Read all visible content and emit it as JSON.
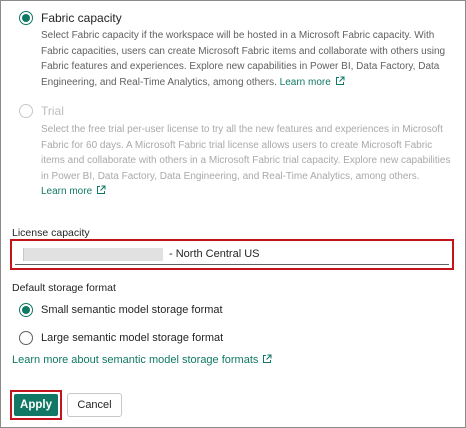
{
  "capacity_options": [
    {
      "label": "Fabric capacity",
      "selected": true,
      "disabled": false,
      "description": "Select Fabric capacity if the workspace will be hosted in a Microsoft Fabric capacity. With Fabric capacities, users can create Microsoft Fabric items and collaborate with others using Fabric features and experiences. Explore new capabilities in Power BI, Data Factory, Data Engineering, and Real-Time Analytics, among others.",
      "learn_more": "Learn more"
    },
    {
      "label": "Trial",
      "selected": false,
      "disabled": true,
      "description": "Select the free trial per-user license to try all the new features and experiences in Microsoft Fabric for 60 days. A Microsoft Fabric trial license allows users to create Microsoft Fabric items and collaborate with others in a Microsoft Fabric trial capacity. Explore new capabilities in Power BI, Data Factory, Data Engineering, and Real-Time Analytics, among others.",
      "learn_more": "Learn more"
    }
  ],
  "license_capacity": {
    "label": "License capacity",
    "value_suffix": "- North Central US"
  },
  "storage_format": {
    "label": "Default storage format",
    "options": [
      {
        "label": "Small semantic model storage format",
        "selected": true
      },
      {
        "label": "Large semantic model storage format",
        "selected": false
      }
    ],
    "learn_more": "Learn more about semantic model storage formats"
  },
  "actions": {
    "apply_label": "Apply",
    "cancel_label": "Cancel"
  },
  "colors": {
    "accent": "#117865",
    "highlight": "#c4141b"
  }
}
